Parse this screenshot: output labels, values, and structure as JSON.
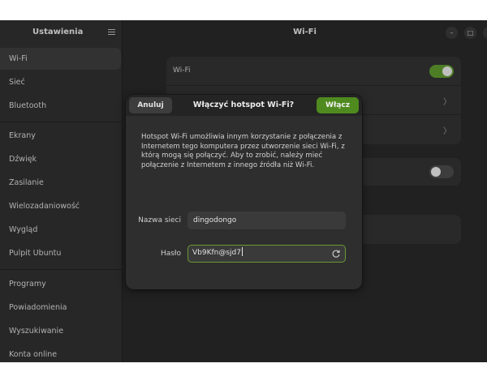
{
  "sidebar": {
    "title": "Ustawienia",
    "groups": [
      [
        {
          "label": "Wi-Fi",
          "active": true
        },
        {
          "label": "Sieć"
        },
        {
          "label": "Bluetooth"
        }
      ],
      [
        {
          "label": "Ekrany"
        },
        {
          "label": "Dźwięk"
        },
        {
          "label": "Zasilanie"
        },
        {
          "label": "Wielozadaniowość"
        },
        {
          "label": "Wygląd"
        },
        {
          "label": "Pulpit Ubuntu"
        }
      ],
      [
        {
          "label": "Programy"
        },
        {
          "label": "Powiadomienia"
        },
        {
          "label": "Wyszukiwanie"
        },
        {
          "label": "Konta online"
        }
      ]
    ]
  },
  "main": {
    "title": "Wi-Fi",
    "wifi_label": "Wi-Fi",
    "wifi_enabled": true
  },
  "window_controls": {
    "minimize": "–",
    "maximize": "□",
    "close": "✕"
  },
  "dialog": {
    "cancel_label": "Anuluj",
    "title": "Włączyć hotspot Wi-Fi?",
    "confirm_label": "Włącz",
    "description": "Hotspot Wi-Fi umożliwia innym korzystanie z połączenia z Internetem tego komputera przez utworzenie sieci Wi-Fi, z którą mogą się połączyć. Aby to zrobić, należy mieć połączenie z Internetem z innego źródła niż Wi-Fi.",
    "network_name_label": "Nazwa sieci",
    "network_name_value": "dingodongo",
    "password_label": "Hasło",
    "password_value": "Vb9Kfn@sjd7"
  },
  "colors": {
    "accent": "#4f8a1f",
    "toggle_on": "#5e9a2f",
    "focus_border": "#6a9a35"
  }
}
